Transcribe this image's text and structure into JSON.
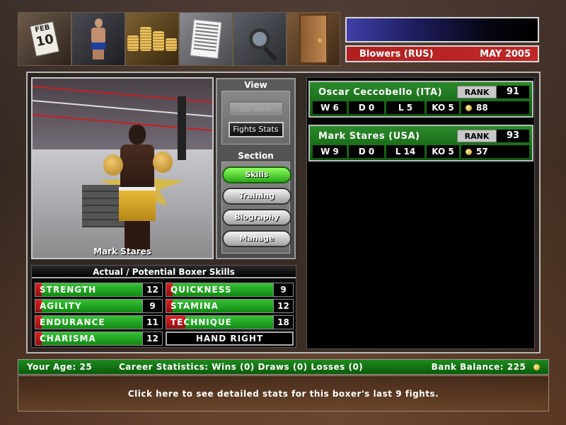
{
  "topbar": {
    "icons": [
      {
        "name": "calendar-icon",
        "month": "FEB",
        "day": "10"
      },
      {
        "name": "boxer-icon"
      },
      {
        "name": "money-icon"
      },
      {
        "name": "document-icon"
      },
      {
        "name": "search-icon"
      },
      {
        "name": "door-icon"
      }
    ]
  },
  "info": {
    "opponent": "Blowers (RUS)",
    "date": "MAY 2005"
  },
  "viewer": {
    "boxer_name": "Mark Stares"
  },
  "view_panel": {
    "heading": "View",
    "buttons": [
      {
        "label": "3D View",
        "state": "disabled"
      },
      {
        "label": "Fights Stats",
        "state": "active"
      }
    ]
  },
  "section_panel": {
    "heading": "Section",
    "buttons": [
      {
        "label": "Skills",
        "active": true
      },
      {
        "label": "Training",
        "active": false
      },
      {
        "label": "Biography",
        "active": false
      },
      {
        "label": "Manage",
        "active": false
      }
    ]
  },
  "skills": {
    "title": "Actual / Potential Boxer Skills",
    "items": [
      {
        "name": "STRENGTH",
        "value": "12",
        "actual_fraction": 0.05,
        "potential_fraction": 0.85
      },
      {
        "name": "QUICKNESS",
        "value": "9",
        "actual_fraction": 0.05,
        "potential_fraction": 0.85
      },
      {
        "name": "AGILITY",
        "value": "9",
        "actual_fraction": 0.05,
        "potential_fraction": 0.85
      },
      {
        "name": "STAMINA",
        "value": "12",
        "actual_fraction": 0.05,
        "potential_fraction": 0.85
      },
      {
        "name": "ENDURANCE",
        "value": "11",
        "actual_fraction": 0.05,
        "potential_fraction": 0.85
      },
      {
        "name": "TECHNIQUE",
        "value": "18",
        "actual_fraction": 0.15,
        "potential_fraction": 0.85
      },
      {
        "name": "CHARISMA",
        "value": "12",
        "actual_fraction": 0.05,
        "potential_fraction": 0.85
      }
    ],
    "hand": "HAND RIGHT"
  },
  "opponents": [
    {
      "name": "Oscar Ceccobello (ITA)",
      "rank_label": "RANK",
      "rank": "91",
      "wins": "W 6",
      "draws": "D 0",
      "losses": "L 5",
      "ko": "KO 5",
      "money": "88"
    },
    {
      "name": "Mark Stares (USA)",
      "rank_label": "RANK",
      "rank": "93",
      "wins": "W 9",
      "draws": "D 0",
      "losses": "L 14",
      "ko": "KO 5",
      "money": "57"
    }
  ],
  "stats_bar": {
    "age": "Your Age: 25",
    "career": "Career Statistics: Wins (0) Draws (0) Losses (0)",
    "bank": "Bank Balance: 225"
  },
  "message": "Click here to see detailed stats for this boxer's last 9 fights."
}
